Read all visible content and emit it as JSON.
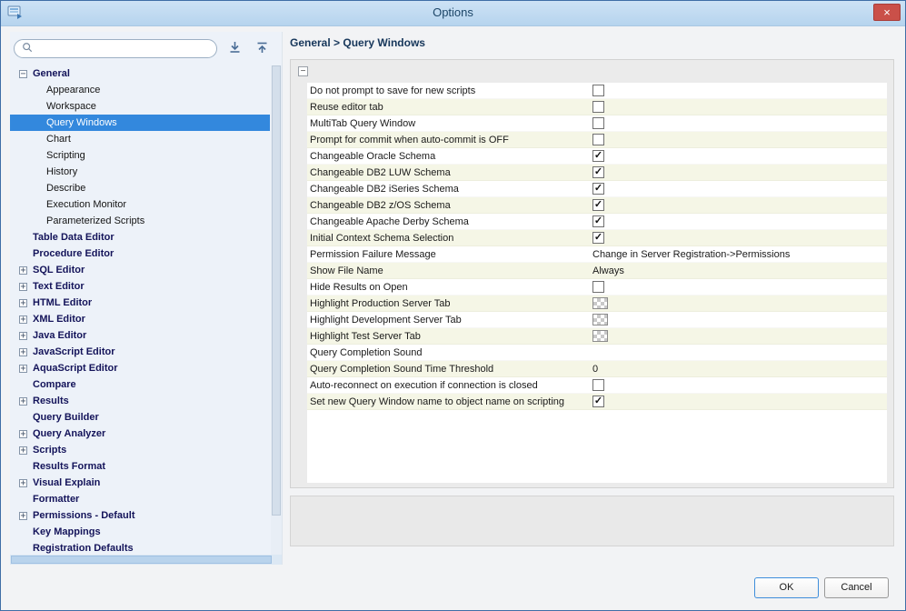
{
  "window": {
    "title": "Options",
    "close_glyph": "×"
  },
  "icons": {
    "minus": "−",
    "plus": "+",
    "check": "✓"
  },
  "colors": {
    "selection": "#3388dd",
    "row_alt": "#f5f6e6",
    "ok_border": "#3f8edb",
    "titlebar_top": "#cde2f5",
    "titlebar_bottom": "#b6d4ee",
    "close_red": "#ca5049"
  },
  "sidebar": {
    "search_placeholder": "",
    "tree": [
      {
        "label": "General",
        "level": 0,
        "expander": "minus",
        "bold": true
      },
      {
        "label": "Appearance",
        "level": 1
      },
      {
        "label": "Workspace",
        "level": 1
      },
      {
        "label": "Query Windows",
        "level": 1,
        "selected": true
      },
      {
        "label": "Chart",
        "level": 1
      },
      {
        "label": "Scripting",
        "level": 1
      },
      {
        "label": "History",
        "level": 1
      },
      {
        "label": "Describe",
        "level": 1
      },
      {
        "label": "Execution Monitor",
        "level": 1
      },
      {
        "label": "Parameterized Scripts",
        "level": 1
      },
      {
        "label": "Table Data Editor",
        "level": 0,
        "bold": true
      },
      {
        "label": "Procedure Editor",
        "level": 0,
        "bold": true
      },
      {
        "label": "SQL Editor",
        "level": 0,
        "expander": "plus",
        "bold": true
      },
      {
        "label": "Text Editor",
        "level": 0,
        "expander": "plus",
        "bold": true
      },
      {
        "label": "HTML Editor",
        "level": 0,
        "expander": "plus",
        "bold": true
      },
      {
        "label": "XML Editor",
        "level": 0,
        "expander": "plus",
        "bold": true
      },
      {
        "label": "Java Editor",
        "level": 0,
        "expander": "plus",
        "bold": true
      },
      {
        "label": "JavaScript Editor",
        "level": 0,
        "expander": "plus",
        "bold": true
      },
      {
        "label": "AquaScript Editor",
        "level": 0,
        "expander": "plus",
        "bold": true
      },
      {
        "label": "Compare",
        "level": 0,
        "bold": true
      },
      {
        "label": "Results",
        "level": 0,
        "expander": "plus",
        "bold": true
      },
      {
        "label": "Query Builder",
        "level": 0,
        "bold": true
      },
      {
        "label": "Query Analyzer",
        "level": 0,
        "expander": "plus",
        "bold": true
      },
      {
        "label": "Scripts",
        "level": 0,
        "expander": "plus",
        "bold": true
      },
      {
        "label": "Results Format",
        "level": 0,
        "bold": true
      },
      {
        "label": "Visual Explain",
        "level": 0,
        "expander": "plus",
        "bold": true
      },
      {
        "label": "Formatter",
        "level": 0,
        "bold": true
      },
      {
        "label": "Permissions - Default",
        "level": 0,
        "expander": "plus",
        "bold": true
      },
      {
        "label": "Key Mappings",
        "level": 0,
        "bold": true
      },
      {
        "label": "Registration Defaults",
        "level": 0,
        "bold": true
      }
    ]
  },
  "breadcrumb": {
    "parts": [
      "General",
      "Query Windows"
    ],
    "separator": ">"
  },
  "settings": {
    "section_collapse_glyph": "−",
    "rows": [
      {
        "label": "Do not prompt to save for new scripts",
        "type": "checkbox",
        "checked": false
      },
      {
        "label": "Reuse editor tab",
        "type": "checkbox",
        "checked": false
      },
      {
        "label": "MultiTab Query Window",
        "type": "checkbox",
        "checked": false
      },
      {
        "label": "Prompt for commit when auto-commit is OFF",
        "type": "checkbox",
        "checked": false
      },
      {
        "label": "Changeable Oracle Schema",
        "type": "checkbox",
        "checked": true
      },
      {
        "label": "Changeable DB2 LUW Schema",
        "type": "checkbox",
        "checked": true
      },
      {
        "label": "Changeable DB2 iSeries Schema",
        "type": "checkbox",
        "checked": true
      },
      {
        "label": "Changeable DB2 z/OS Schema",
        "type": "checkbox",
        "checked": true
      },
      {
        "label": "Changeable Apache Derby Schema",
        "type": "checkbox",
        "checked": true
      },
      {
        "label": "Initial Context Schema Selection",
        "type": "checkbox",
        "checked": true
      },
      {
        "label": "Permission Failure Message",
        "type": "text",
        "value": "Change in Server Registration->Permissions"
      },
      {
        "label": "Show File Name",
        "type": "text",
        "value": "Always"
      },
      {
        "label": "Hide Results on Open",
        "type": "checkbox",
        "checked": false
      },
      {
        "label": "Highlight Production Server Tab",
        "type": "swatch"
      },
      {
        "label": "Highlight Development Server Tab",
        "type": "swatch"
      },
      {
        "label": "Highlight Test Server Tab",
        "type": "swatch"
      },
      {
        "label": "Query Completion Sound",
        "type": "empty"
      },
      {
        "label": "Query Completion Sound Time Threshold",
        "type": "text",
        "value": "0"
      },
      {
        "label": "Auto-reconnect on execution if connection is closed",
        "type": "checkbox",
        "checked": false
      },
      {
        "label": "Set new Query Window name to object name on scripting",
        "type": "checkbox",
        "checked": true
      }
    ]
  },
  "footer": {
    "ok": "OK",
    "cancel": "Cancel"
  }
}
